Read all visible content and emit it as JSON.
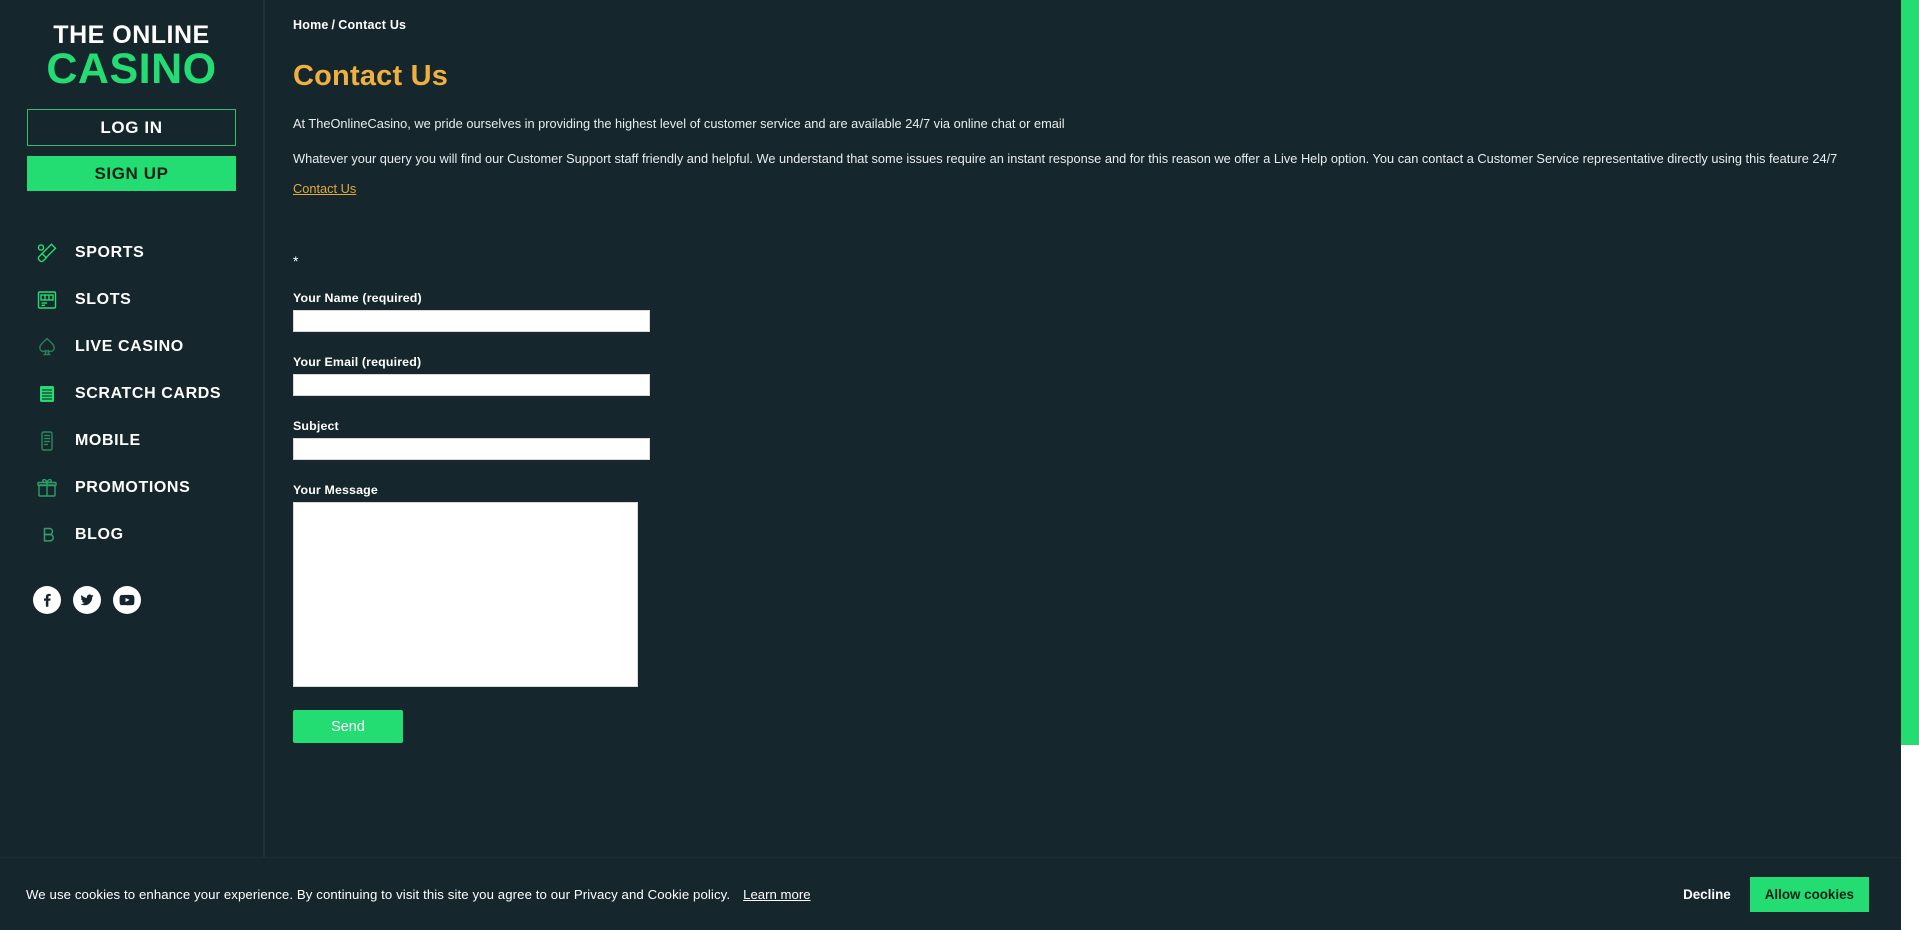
{
  "sidebar": {
    "logo": {
      "line1": "THE ONLINE",
      "line2": "CASINO"
    },
    "login_label": "LOG IN",
    "signup_label": "SIGN UP",
    "nav_items": [
      {
        "label": "SPORTS",
        "icon": "cricket-bat-ball-icon"
      },
      {
        "label": "SLOTS",
        "icon": "slot-machine-icon"
      },
      {
        "label": "LIVE CASINO",
        "icon": "spade-icon"
      },
      {
        "label": "SCRATCH CARDS",
        "icon": "scratch-cards-icon"
      },
      {
        "label": "MOBILE",
        "icon": "mobile-phone-icon"
      },
      {
        "label": "PROMOTIONS",
        "icon": "gift-icon"
      },
      {
        "label": "BLOG",
        "icon": "blog-icon"
      }
    ],
    "socials": [
      {
        "name": "facebook-icon"
      },
      {
        "name": "twitter-icon"
      },
      {
        "name": "youtube-icon"
      }
    ]
  },
  "main": {
    "breadcrumb": {
      "home": "Home",
      "separator": "/",
      "current": "Contact Us"
    },
    "title": "Contact Us",
    "paragraph1": "At TheOnlineCasino, we pride ourselves in providing the highest level of customer service and are available 24/7 via online chat or email",
    "paragraph2": "Whatever your query you will find our Customer Support staff friendly and helpful. We understand that some issues require an instant response and for this reason we offer a Live Help option. You can contact a Customer Service representative directly using this feature 24/7",
    "contact_link": "Contact Us",
    "form": {
      "asterisk": "*",
      "name_label": "Your Name (required)",
      "name_value": "",
      "email_label": "Your Email (required)",
      "email_value": "",
      "subject_label": "Subject",
      "subject_value": "",
      "message_label": "Your Message",
      "message_value": "",
      "send_label": "Send"
    }
  },
  "cookie_bar": {
    "text": "We use cookies to enhance your experience. By continuing to visit this site you agree to our Privacy and Cookie policy.",
    "learn_more": "Learn more",
    "decline_label": "Decline",
    "allow_label": "Allow cookies"
  },
  "colors": {
    "background": "#15262c",
    "accent_green": "#23dd72",
    "title_gold": "#f0b040",
    "link_gold": "#e3a93a",
    "text_white": "#ffffff"
  }
}
